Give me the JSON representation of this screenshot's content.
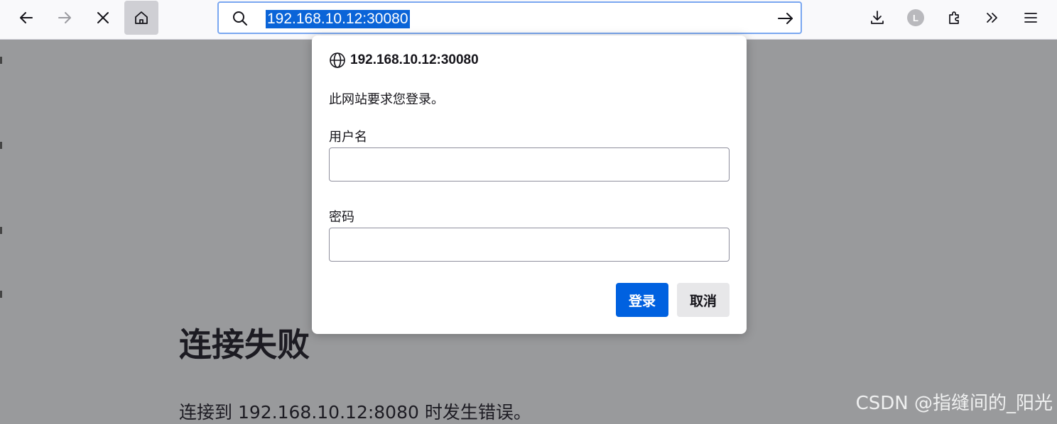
{
  "toolbar": {
    "back_icon": "arrow-left-icon",
    "forward_icon": "arrow-right-icon",
    "stop_icon": "close-icon",
    "home_icon": "home-icon",
    "url": "192.168.10.12:30080",
    "downloads_icon": "download-icon",
    "account_initial": "L",
    "extensions_icon": "puzzle-icon",
    "overflow_icon": "double-chevron-icon",
    "menu_icon": "hamburger-icon"
  },
  "dialog": {
    "host": "192.168.10.12:30080",
    "message": "此网站要求您登录。",
    "username_label": "用户名",
    "username_value": "",
    "password_label": "密码",
    "password_value": "",
    "login_button": "登录",
    "cancel_button": "取消"
  },
  "page": {
    "error_title": "连接失败",
    "error_description": "连接到 192.168.10.12:8080 时发生错误。"
  },
  "watermark": "CSDN @指缝间的_阳光",
  "colors": {
    "accent": "#0061e0",
    "url_highlight": "#0a64d8",
    "overlay_bg": "#999a9c"
  }
}
